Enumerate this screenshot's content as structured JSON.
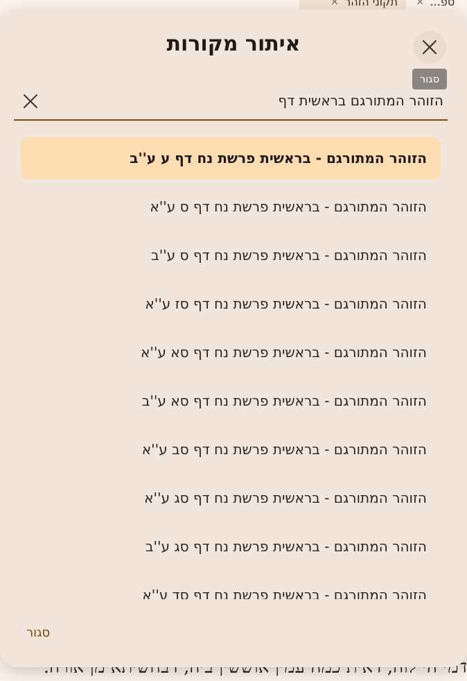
{
  "background": {
    "tabs": [
      {
        "label": "תקוני הזהר",
        "close": "×"
      },
      {
        "label": "ספ...",
        "close": "×"
      }
    ],
    "page_text": "דמי הי לוה, דאית כמה עמין אוששין ביה, דבחשיתא מן אורה."
  },
  "dialog": {
    "title": "איתור מקורות",
    "close_tooltip": "סגור",
    "search": {
      "value": "הזוהר המתורגם בראשית דף",
      "placeholder": ""
    },
    "results": [
      "הזוהר המתורגם - בראשית פרשת נח דף ע ע''ב",
      "הזוהר המתורגם - בראשית פרשת נח דף ס ע''א",
      "הזוהר המתורגם - בראשית פרשת נח דף ס ע''ב",
      "הזוהר המתורגם - בראשית פרשת נח דף סז ע''א",
      "הזוהר המתורגם - בראשית פרשת נח דף סא ע''א",
      "הזוהר המתורגם - בראשית פרשת נח דף סא ע''ב",
      "הזוהר המתורגם - בראשית פרשת נח דף סב ע''א",
      "הזוהר המתורגם - בראשית פרשת נח דף סג ע''א",
      "הזוהר המתורגם - בראשית פרשת נח דף סג ע''ב",
      "הזוהר המתורגם - בראשית פרשת נח דף סד ע''א"
    ],
    "selected_index": 0,
    "footer_close_label": "סגור"
  },
  "colors": {
    "accent": "#7a4a12",
    "selected_bg": "#fcdcb0",
    "dialog_bg": "#f2e6dc"
  }
}
